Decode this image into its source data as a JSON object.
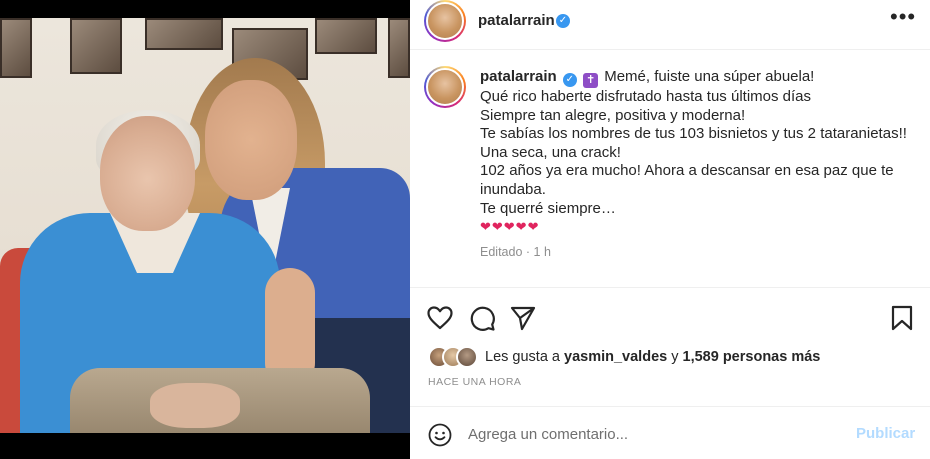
{
  "post": {
    "username": "patalarrain",
    "verified_glyph": "✓",
    "more_glyph": "•••"
  },
  "caption": {
    "first_line_text": "Memé, fuiste una súper abuela!",
    "cross_emoji": "✝",
    "lines": [
      "Qué rico haberte disfrutado hasta tus últimos días",
      "Siempre tan alegre, positiva y moderna!",
      "Te sabías los nombres de tus 103 bisnietos y tus 2 tataranietas!!",
      "Una seca, una crack!",
      "102 años ya era mucho! Ahora a descansar en esa paz que te",
      "inundaba.",
      "Te querré siempre…"
    ],
    "hearts": "❤❤❤❤❤",
    "edited": "Editado",
    "separator": "·",
    "time": "1 h"
  },
  "actions": {
    "like_icon": "heart-outline-icon",
    "comment_icon": "comment-icon",
    "share_icon": "paper-plane-icon",
    "save_icon": "bookmark-icon"
  },
  "likes": {
    "prefix": "Les gusta a",
    "user": "yasmin_valdes",
    "conjunction": "y",
    "count_text": "1,589 personas más"
  },
  "timestamp": "HACE UNA HORA",
  "comment": {
    "placeholder": "Agrega un comentario...",
    "publish_label": "Publicar"
  },
  "colors": {
    "verified": "#3897f0",
    "publish_disabled": "#b3dbff",
    "muted": "#8e8e8e",
    "text": "#262626"
  }
}
